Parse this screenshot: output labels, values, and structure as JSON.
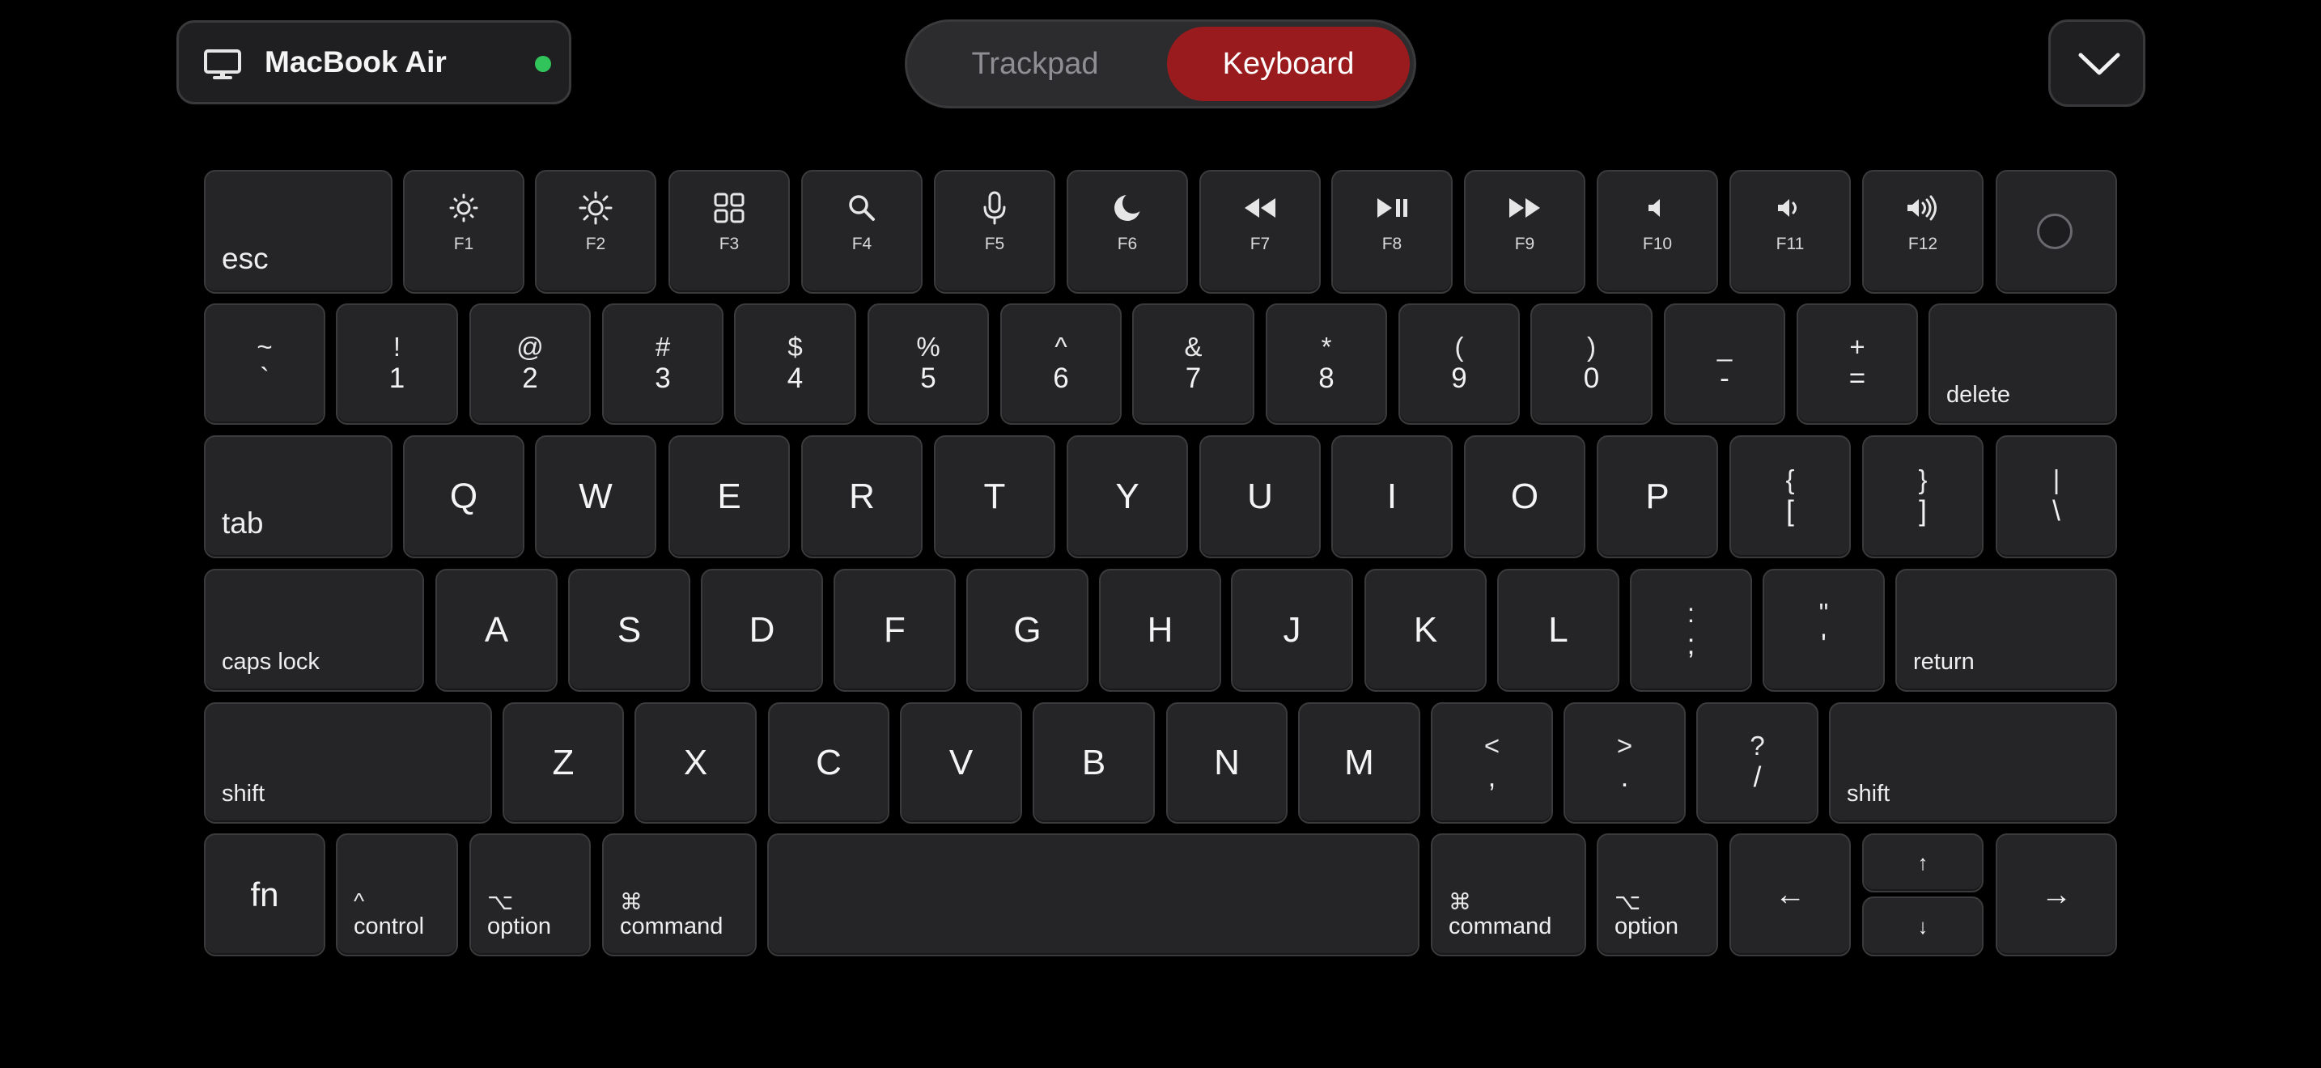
{
  "header": {
    "device_name": "MacBook Air",
    "device_icon": "monitor-icon",
    "status_color": "#31c45a",
    "modes": {
      "trackpad": "Trackpad",
      "keyboard": "Keyboard",
      "active": "Keyboard"
    },
    "accent_color": "#9a1b1e",
    "collapse_icon": "chevron-down-icon"
  },
  "keyboard": {
    "function_row": {
      "esc": "esc",
      "f1": "F1",
      "f2": "F2",
      "f3": "F3",
      "f4": "F4",
      "f5": "F5",
      "f6": "F6",
      "f7": "F7",
      "f8": "F8",
      "f9": "F9",
      "f10": "F10",
      "f11": "F11",
      "f12": "F12"
    },
    "number_row": {
      "grave": {
        "top": "~",
        "bottom": "`"
      },
      "k1": {
        "top": "!",
        "bottom": "1"
      },
      "k2": {
        "top": "@",
        "bottom": "2"
      },
      "k3": {
        "top": "#",
        "bottom": "3"
      },
      "k4": {
        "top": "$",
        "bottom": "4"
      },
      "k5": {
        "top": "%",
        "bottom": "5"
      },
      "k6": {
        "top": "^",
        "bottom": "6"
      },
      "k7": {
        "top": "&",
        "bottom": "7"
      },
      "k8": {
        "top": "*",
        "bottom": "8"
      },
      "k9": {
        "top": "(",
        "bottom": "9"
      },
      "k0": {
        "top": ")",
        "bottom": "0"
      },
      "minus": {
        "top": "_",
        "bottom": "-"
      },
      "equal": {
        "top": "+",
        "bottom": "="
      },
      "delete": "delete"
    },
    "qwerty_row": {
      "tab": "tab",
      "q": "Q",
      "w": "W",
      "e": "E",
      "r": "R",
      "t": "T",
      "y": "Y",
      "u": "U",
      "i": "I",
      "o": "O",
      "p": "P",
      "lbracket": {
        "top": "{",
        "bottom": "["
      },
      "rbracket": {
        "top": "}",
        "bottom": "]"
      },
      "backslash": {
        "top": "|",
        "bottom": "\\"
      }
    },
    "home_row": {
      "caps_lock": "caps lock",
      "a": "A",
      "s": "S",
      "d": "D",
      "f": "F",
      "g": "G",
      "h": "H",
      "j": "J",
      "k": "K",
      "l": "L",
      "semicolon": {
        "top": ":",
        "bottom": ";"
      },
      "quote": {
        "top": "\"",
        "bottom": "'"
      },
      "return": "return"
    },
    "bottom_row": {
      "shift_left": "shift",
      "z": "Z",
      "x": "X",
      "c": "C",
      "v": "V",
      "b": "B",
      "n": "N",
      "m": "M",
      "comma": {
        "top": "<",
        "bottom": ","
      },
      "period": {
        "top": ">",
        "bottom": "."
      },
      "slash": {
        "top": "?",
        "bottom": "/"
      },
      "shift_right": "shift"
    },
    "modifier_row": {
      "fn": "fn",
      "control": {
        "symbol": "^",
        "label": "control"
      },
      "option_left": {
        "symbol": "⌥",
        "label": "option"
      },
      "command_left": {
        "symbol": "⌘",
        "label": "command"
      },
      "command_right": {
        "symbol": "⌘",
        "label": "command"
      },
      "option_right": {
        "symbol": "⌥",
        "label": "option"
      },
      "arrow_left": "←",
      "arrow_up": "↑",
      "arrow_down": "↓",
      "arrow_right": "→"
    }
  }
}
